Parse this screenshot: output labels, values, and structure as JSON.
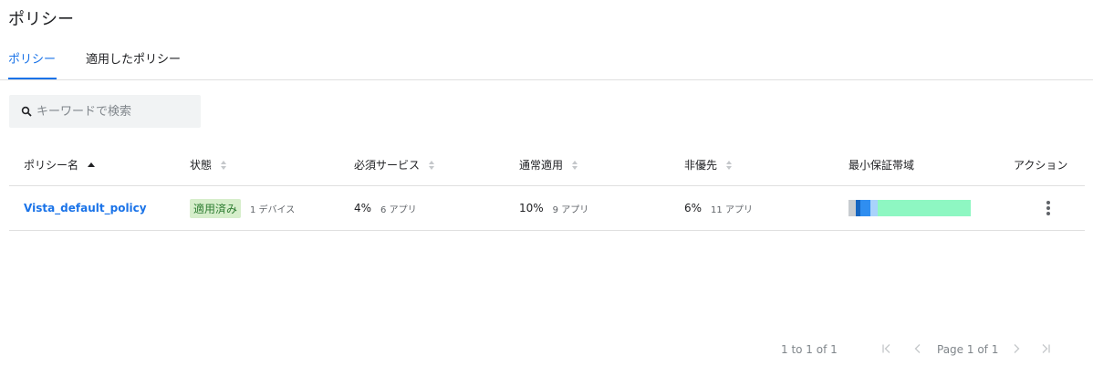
{
  "page": {
    "title": "ポリシー"
  },
  "tabs": [
    {
      "label": "ポリシー",
      "active": true
    },
    {
      "label": "適用したポリシー",
      "active": false
    }
  ],
  "search": {
    "placeholder": "キーワードで検索",
    "value": ""
  },
  "table": {
    "columns": [
      {
        "label": "ポリシー名",
        "sort": "asc"
      },
      {
        "label": "状態",
        "sort": "none"
      },
      {
        "label": "必須サービス",
        "sort": "none"
      },
      {
        "label": "通常適用",
        "sort": "none"
      },
      {
        "label": "非優先",
        "sort": "none"
      },
      {
        "label": "最小保証帯域",
        "sort": "none"
      },
      {
        "label": "アクション",
        "sort": "none"
      }
    ],
    "rows": [
      {
        "name": "Vista_default_policy",
        "status": "適用済み",
        "devices": "1 デバイス",
        "required_pct": "4%",
        "required_apps": "6 アプリ",
        "normal_pct": "10%",
        "normal_apps": "9 アプリ",
        "low_pct": "6%",
        "low_apps": "11 アプリ",
        "bandwidth": [
          {
            "color": "#c8ccd0",
            "fraction": 0.06
          },
          {
            "color": "#1565c0",
            "fraction": 0.04
          },
          {
            "color": "#2f8ef0",
            "fraction": 0.08
          },
          {
            "color": "#a9d3fb",
            "fraction": 0.06
          },
          {
            "color": "#8ef7c2",
            "fraction": 0.76
          }
        ]
      }
    ]
  },
  "pagination": {
    "range": "1 to 1 of 1",
    "page": "Page 1 of 1"
  },
  "colors": {
    "accent": "#1a73e8",
    "badge_bg": "#d6eecb",
    "badge_text": "#2e7d32"
  }
}
